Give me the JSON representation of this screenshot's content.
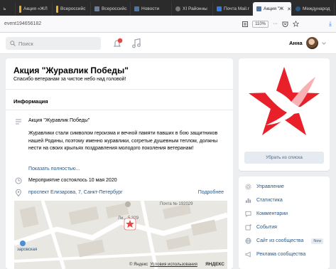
{
  "browser": {
    "tabs": [
      {
        "label": "ь",
        "color": "#2b2b2b"
      },
      {
        "label": "Акция «ЖЛ",
        "color": "#e8b22e"
      },
      {
        "label": "Всероссийс",
        "color": "#e8b22e"
      },
      {
        "label": "Всероссийс",
        "color": "#6a7f99"
      },
      {
        "label": "Новости",
        "color": "#4a76a8"
      },
      {
        "label": "XI Районны",
        "color": "#555555"
      },
      {
        "label": "Почта Mail.r",
        "color": "#2f7de1"
      },
      {
        "label": "Акция \"Ж",
        "color": "#4a76a8",
        "active": true
      },
      {
        "label": "Международ",
        "color": "#2a5885"
      }
    ],
    "close_glyph": "✕",
    "url": "event194656182",
    "zoom": "110%",
    "menu_dots": "···",
    "download_glyph": "⤓"
  },
  "header": {
    "search_placeholder": "Поиск",
    "user_name": "Анна",
    "notification_color": "#e64646"
  },
  "event": {
    "title": "Акция \"Журавлик Победы\"",
    "subtitle": "Спасибо ветеранам за чистое небо над головой!",
    "info_heading": "Информация",
    "desc_title": "Акция \"Журавлик Победы\"",
    "description": "Журавлики стали символом героизма и вечной памяти павших в бою защитников нашей Родины, поэтому именно журавлики, согретые душевным теплом, должны нести на своих крыльях поздравления молодого поколения ветеранам!",
    "show_more": "Показать полностью...",
    "ended": "Мероприятие состоялось 10 мая 2020",
    "address": "проспект Елизарова, 7, Санкт-Петербург",
    "details": "Подробнее"
  },
  "map": {
    "label_post": "Почта № 192029",
    "label_house": "Ли... 5 329",
    "label_district": "заровская",
    "copyright": "© Яндекс",
    "terms": "Условия использования",
    "brand": "ЯНДЕКС",
    "marker_color": "#e64646"
  },
  "sidebar": {
    "remove_button": "Убрать из списка",
    "logo_color": "#e8202a",
    "menu": [
      {
        "label": "Управление",
        "icon": "gear-icon"
      },
      {
        "label": "Статистика",
        "icon": "chart-icon"
      },
      {
        "label": "Комментарии",
        "icon": "comment-icon"
      },
      {
        "label": "События",
        "icon": "events-icon"
      },
      {
        "label": "Сайт из сообщества",
        "icon": "globe-icon",
        "badge": "New"
      },
      {
        "label": "Реклама сообщества",
        "icon": "megaphone-icon"
      }
    ]
  }
}
